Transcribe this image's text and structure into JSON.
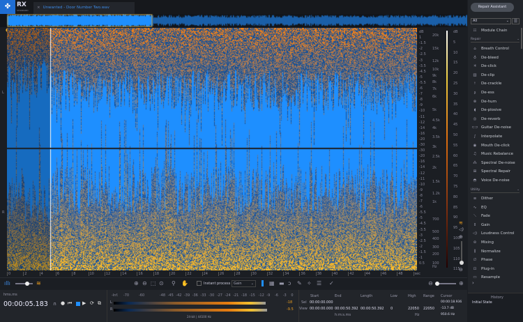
{
  "app": {
    "logo": "RX",
    "logo_sub": "STANDARD",
    "file_tab": "Unwanted - Door Number Two.wav",
    "close": "×"
  },
  "repair_assistant": "Repair Assistant",
  "modules": {
    "filter": "All",
    "module_chain": "Module Chain",
    "repair_header": "Repair",
    "repair": [
      {
        "label": "Breath Control",
        "icon": "breath-icon"
      },
      {
        "label": "De-bleed",
        "icon": "bulb-icon"
      },
      {
        "label": "De-click",
        "icon": "click-icon"
      },
      {
        "label": "De-clip",
        "icon": "clip-icon"
      },
      {
        "label": "De-crackle",
        "icon": "crackle-icon"
      },
      {
        "label": "De-ess",
        "icon": "ess-icon"
      },
      {
        "label": "De-hum",
        "icon": "hum-icon"
      },
      {
        "label": "De-plosive",
        "icon": "plosive-icon"
      },
      {
        "label": "De-reverb",
        "icon": "reverb-icon"
      },
      {
        "label": "Guitar De-noise",
        "icon": "guitar-icon"
      },
      {
        "label": "Interpolate",
        "icon": "interpolate-icon"
      },
      {
        "label": "Mouth De-click",
        "icon": "mouth-icon"
      },
      {
        "label": "Music Rebalance",
        "icon": "rebalance-icon"
      },
      {
        "label": "Spectral De-noise",
        "icon": "spectral-denoise-icon"
      },
      {
        "label": "Spectral Repair",
        "icon": "spectral-repair-icon"
      },
      {
        "label": "Voice De-noise",
        "icon": "voice-icon"
      }
    ],
    "utility_header": "Utility",
    "utility": [
      {
        "label": "Dither",
        "icon": "dither-icon"
      },
      {
        "label": "EQ",
        "icon": "eq-icon"
      },
      {
        "label": "Fade",
        "icon": "fade-icon"
      },
      {
        "label": "Gain",
        "icon": "gain-icon"
      },
      {
        "label": "Loudness Control",
        "icon": "loudness-icon"
      },
      {
        "label": "Mixing",
        "icon": "mixing-icon"
      },
      {
        "label": "Normalize",
        "icon": "normalize-icon"
      },
      {
        "label": "Phase",
        "icon": "phase-icon"
      },
      {
        "label": "Plug-in",
        "icon": "plugin-icon"
      },
      {
        "label": "Resample",
        "icon": "resample-icon"
      }
    ]
  },
  "history": {
    "title": "History",
    "items": [
      "Initial State"
    ]
  },
  "axes": {
    "db_left": [
      "dB",
      "1",
      "-1.5",
      "-2",
      "-2.5",
      "-3",
      "-3.5",
      "-4.5",
      "-5",
      "-5.5",
      "-6",
      "-7",
      "-8",
      "-9",
      "-10",
      "-11",
      "-12",
      "-14",
      "-16",
      "-20",
      "-30",
      "-30",
      "-20",
      "-16",
      "-14",
      "-12",
      "-11",
      "-10",
      "-9",
      "-8",
      "-7",
      "-6",
      "-5.5",
      "-5",
      "-4.5",
      "-3.5",
      "-3",
      "-2.5",
      "-2",
      "-1.5",
      "-1",
      "0.5"
    ],
    "hz": [
      "20k",
      "15k",
      "12k",
      "10k",
      "9k",
      "8k",
      "7k",
      "6k",
      "5k",
      "4.5k",
      "4k",
      "3.5k",
      "3k",
      "2.5k",
      "2k",
      "1.5k",
      "1.2k",
      "1k",
      "700",
      "500",
      "400",
      "300",
      "200",
      "100",
      "Hz"
    ],
    "db_right": [
      "dB",
      "5",
      "10",
      "15",
      "20",
      "25",
      "30",
      "35",
      "40",
      "45",
      "50",
      "55",
      "60",
      "65",
      "70",
      "75",
      "80",
      "85",
      "90",
      "95",
      "100",
      "105",
      "110",
      "115"
    ],
    "time": [
      "0",
      "2",
      "4",
      "6",
      "8",
      "10",
      "12",
      "14",
      "16",
      "18",
      "20",
      "22",
      "24",
      "26",
      "28",
      "30",
      "32",
      "34",
      "36",
      "38",
      "40",
      "42",
      "44",
      "46",
      "48",
      "sec"
    ],
    "channels": [
      "L",
      "R"
    ]
  },
  "toolbar": {
    "instant_process": "Instant process",
    "process_mode": "Gain"
  },
  "transport": {
    "time_format": "hms.ms",
    "time": "00:00:05.183"
  },
  "meter": {
    "scale": [
      "-Inf.",
      "-70",
      "-60",
      "-48",
      "-45",
      "-42",
      "-39",
      "-36",
      "-33",
      "-30",
      "-27",
      "-24",
      "-21",
      "-18",
      "-15",
      "-12",
      "-9",
      "-6",
      "-3",
      "0"
    ],
    "channels": [
      "L",
      "R"
    ],
    "peak_l": "-18",
    "peak_r": "-9.5",
    "format": "24-bit | 44100 Hz",
    "level_l": 0.87,
    "level_r": 0.88
  },
  "selection": {
    "headers": [
      "Start",
      "End",
      "Length"
    ],
    "sel_label": "Sel",
    "view_label": "View",
    "sel_start": "00:00:00.000",
    "view_start": "00:00:00.000",
    "view_end": "00:00:50.392",
    "view_length": "00:00:50.392",
    "unit": "h:m:s.ms"
  },
  "freq": {
    "headers": [
      "Low",
      "High",
      "Range"
    ],
    "low": "0",
    "high": "22050",
    "range": "22050",
    "unit": "Hz"
  },
  "cursor": {
    "label": "Cursor",
    "time": "00:00:18.936",
    "level": "-13.7 dB",
    "freq": "950.6 Hz"
  },
  "colors": {
    "accent": "#1f6ed4",
    "waveform": "#1e8fff",
    "spectro_hot": "#f08a10"
  }
}
